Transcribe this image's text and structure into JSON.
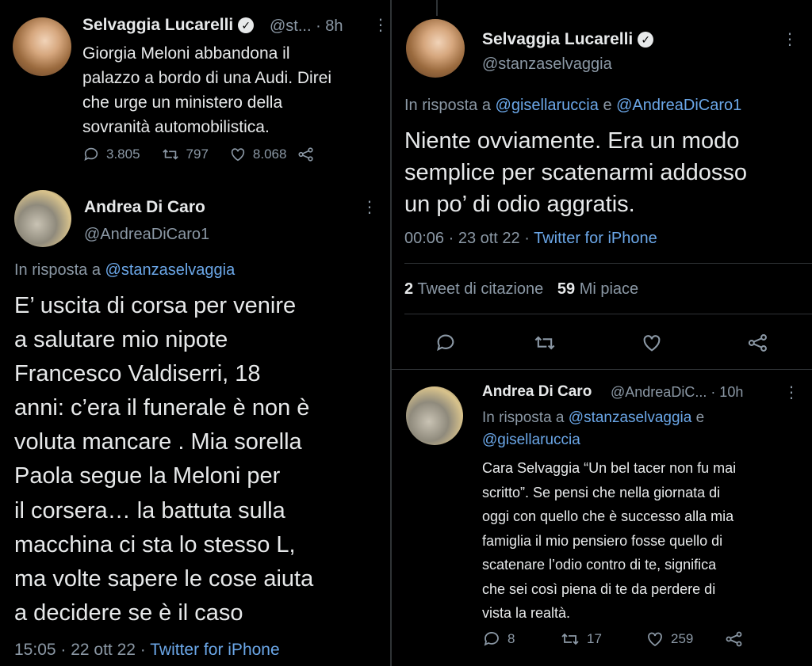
{
  "left_top": {
    "name": "Selvaggia Lucarelli",
    "handle_time": "@st... · 8h",
    "text_lines": [
      "Giorgia Meloni abbandona il",
      "palazzo a bordo di una Audi. Direi",
      "che urge un ministero della",
      "sovranità automobilistica."
    ],
    "replies": "3.805",
    "retweets": "797",
    "likes": "8.068"
  },
  "left_main": {
    "name": "Andrea Di Caro",
    "handle": "@AndreaDiCaro1",
    "reply_prefix": "In risposta a",
    "reply_to": "@stanzaselvaggia",
    "text_lines": [
      "E’ uscita di corsa per venire",
      "a salutare mio nipote",
      "Francesco Valdiserri, 18",
      "anni: c’era il funerale è non è",
      "voluta mancare . Mia sorella",
      "Paola segue la Meloni per",
      "il corsera… la battuta sulla",
      "macchina ci sta lo stesso L,",
      "ma volte sapere le cose aiuta",
      "a decidere se è il caso"
    ],
    "timestamp": "15:05 · 22 ott 22 ·",
    "source": "Twitter for iPhone"
  },
  "right_main": {
    "name": "Selvaggia Lucarelli",
    "handle": "@stanzaselvaggia",
    "reply_prefix": "In risposta a",
    "reply_to_1": "@gisellaruccia",
    "reply_joiner": "e",
    "reply_to_2": "@AndreaDiCaro1",
    "text_lines": [
      "Niente ovviamente. Era un modo",
      "semplice per scatenarmi addosso",
      "un po’ di odio aggratis."
    ],
    "timestamp": "00:06 · 23 ott 22 ·",
    "source": "Twitter for iPhone",
    "quote_count": "2",
    "quote_label": "Tweet di citazione",
    "like_count": "59",
    "like_label": "Mi piace"
  },
  "right_reply": {
    "name": "Andrea Di Caro",
    "handle_time": "@AndreaDiC...  · 10h",
    "reply_prefix": "In risposta a",
    "reply_to_1": "@stanzaselvaggia",
    "reply_joiner": "e",
    "reply_to_2": "@gisellaruccia",
    "text_lines": [
      "Cara Selvaggia “Un bel tacer non fu mai",
      "scritto”. Se pensi che nella giornata di",
      "oggi con quello che è successo alla mia",
      "famiglia il mio pensiero fosse quello di",
      "scatenare l’odio contro di te, significa",
      "che sei così piena di te da perdere di",
      "vista la realtà."
    ],
    "replies": "8",
    "retweets": "17",
    "likes": "259"
  }
}
